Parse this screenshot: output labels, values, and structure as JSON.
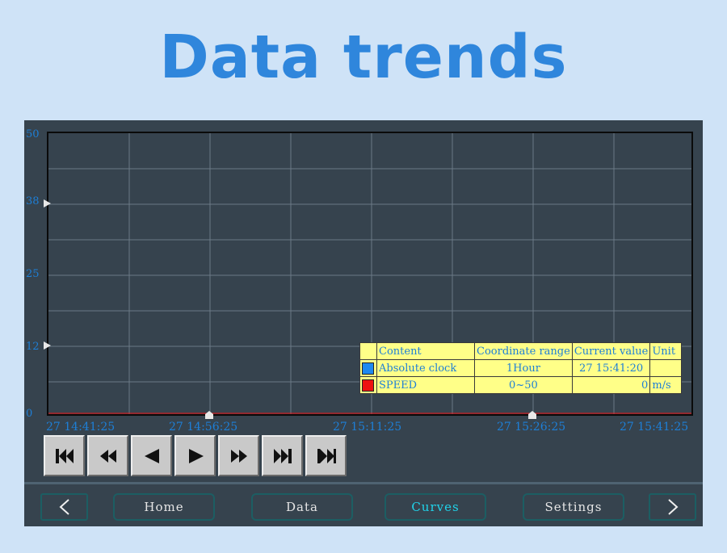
{
  "title": "Data trends",
  "y_axis": {
    "ticks": [
      "50",
      "38",
      "25",
      "12",
      "0"
    ]
  },
  "x_axis": {
    "ticks": [
      "27 14:41:25",
      "27 14:56:25",
      "27 15:11:25",
      "27 15:26:25",
      "27 15:41:25"
    ]
  },
  "legend": {
    "headers": {
      "content": "Content",
      "range": "Coordinate range",
      "current": "Current value",
      "unit": "Unit"
    },
    "rows": [
      {
        "color": "#1e88f0",
        "content": "Absolute clock",
        "range": "1Hour",
        "current": "27 15:41:20",
        "unit": ""
      },
      {
        "color": "#ee1111",
        "content": "SPEED",
        "range": "0~50",
        "current": "0",
        "unit": "m/s"
      }
    ]
  },
  "transport": [
    "skip-to-start-icon",
    "rewind-icon",
    "step-back-icon",
    "play-icon",
    "fast-forward-icon",
    "skip-to-end-icon",
    "skip-next-icon"
  ],
  "nav": {
    "prev": "<",
    "home": "Home",
    "data": "Data",
    "curves": "Curves",
    "settings": "Settings",
    "next": ">",
    "active": "Curves"
  },
  "colors": {
    "background": "#cfe3f7",
    "title": "#2f86dc",
    "screen": "#36434e",
    "axis_text": "#1e7fd6",
    "legend_bg": "#ffff88",
    "nav_border": "#1c5e63",
    "nav_active": "#20d3ea"
  }
}
